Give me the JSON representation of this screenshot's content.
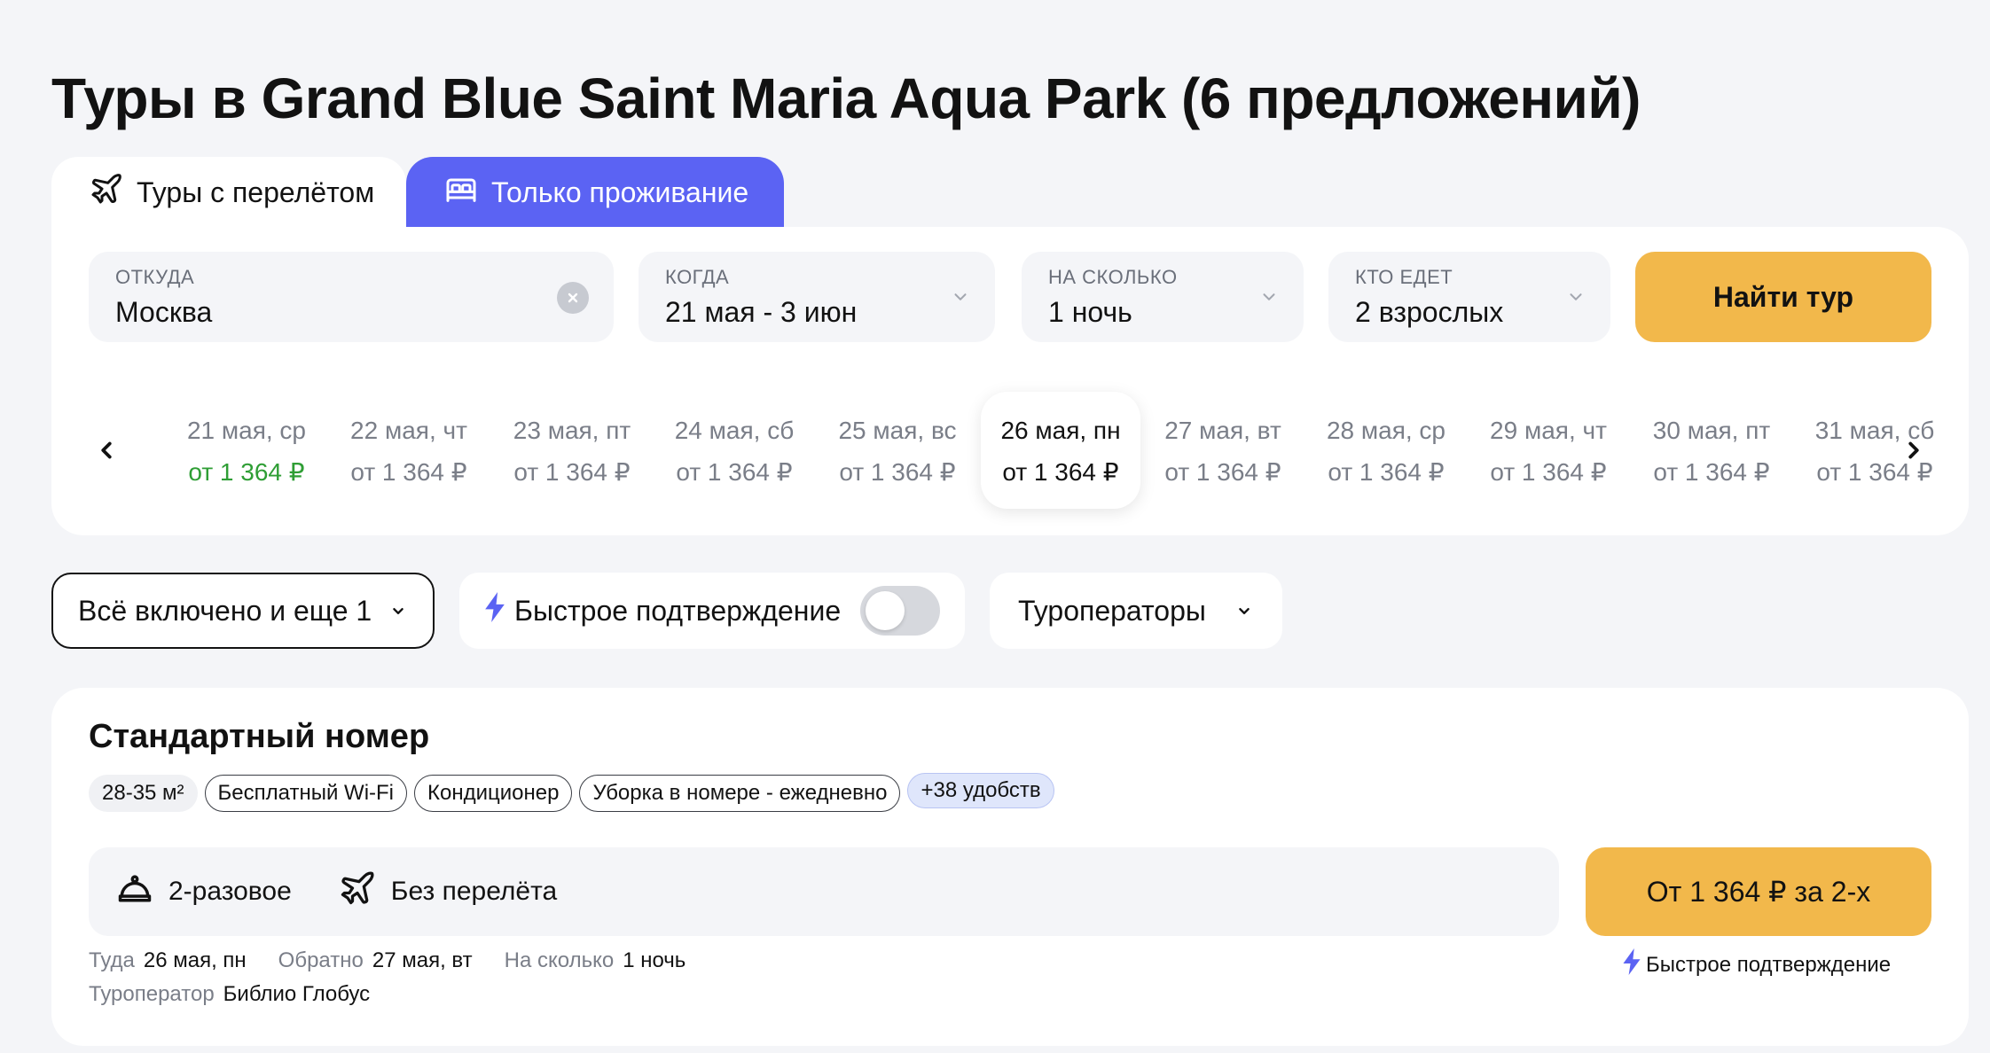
{
  "page": {
    "title": "Туры в Grand Blue Saint Maria Aqua Park (6 предложений)"
  },
  "tabs": [
    {
      "label": "Туры с перелётом",
      "icon": "plane-icon",
      "active": false
    },
    {
      "label": "Только проживание",
      "icon": "bed-icon",
      "active": true
    }
  ],
  "search": {
    "from": {
      "label": "ОТКУДА",
      "value": "Москва"
    },
    "when": {
      "label": "КОГДА",
      "value": "21 мая - 3 июн"
    },
    "nights": {
      "label": "НА СКОЛЬКО",
      "value": "1 ночь"
    },
    "who": {
      "label": "КТО ЕДЕТ",
      "value": "2 взрослых"
    },
    "submit_label": "Найти тур"
  },
  "dates": [
    {
      "day": "21 мая, ср",
      "price": "от 1 364 ₽",
      "cheapest": true,
      "selected": false
    },
    {
      "day": "22 мая, чт",
      "price": "от 1 364 ₽",
      "cheapest": false,
      "selected": false
    },
    {
      "day": "23 мая, пт",
      "price": "от 1 364 ₽",
      "cheapest": false,
      "selected": false
    },
    {
      "day": "24 мая, сб",
      "price": "от 1 364 ₽",
      "cheapest": false,
      "selected": false
    },
    {
      "day": "25 мая, вс",
      "price": "от 1 364 ₽",
      "cheapest": false,
      "selected": false
    },
    {
      "day": "26 мая, пн",
      "price": "от 1 364 ₽",
      "cheapest": false,
      "selected": true
    },
    {
      "day": "27 мая, вт",
      "price": "от 1 364 ₽",
      "cheapest": false,
      "selected": false
    },
    {
      "day": "28 мая, ср",
      "price": "от 1 364 ₽",
      "cheapest": false,
      "selected": false
    },
    {
      "day": "29 мая, чт",
      "price": "от 1 364 ₽",
      "cheapest": false,
      "selected": false
    },
    {
      "day": "30 мая, пт",
      "price": "от 1 364 ₽",
      "cheapest": false,
      "selected": false
    },
    {
      "day": "31 мая, сб",
      "price": "от 1 364 ₽",
      "cheapest": false,
      "selected": false
    }
  ],
  "filters": {
    "board": "Всё включено и еще 1",
    "fast_confirm": "Быстрое подтверждение",
    "fast_confirm_on": false,
    "operators": "Туроператоры"
  },
  "room": {
    "title": "Стандартный номер",
    "amenities": [
      "28-35 м²",
      "Бесплатный Wi-Fi",
      "Кондиционер",
      "Уборка в номере - ежедневно"
    ],
    "more_amenities": "+38 удобств",
    "meal": "2-разовое",
    "flight": "Без перелёта",
    "price_label": "От 1 364 ₽ за 2-х",
    "fast_confirm": "Быстрое подтверждение",
    "meta": {
      "depart_label": "Туда",
      "depart_value": "26 мая, пн",
      "return_label": "Обратно",
      "return_value": "27 мая, вт",
      "nights_label": "На сколько",
      "nights_value": "1 ночь",
      "operator_label": "Туроператор",
      "operator_value": "Библио Глобус"
    }
  },
  "colors": {
    "accent": "#5b63f3",
    "cta": "#f2b84b",
    "cheapest_price": "#2f9e35",
    "lightning": "#5b63f3"
  }
}
